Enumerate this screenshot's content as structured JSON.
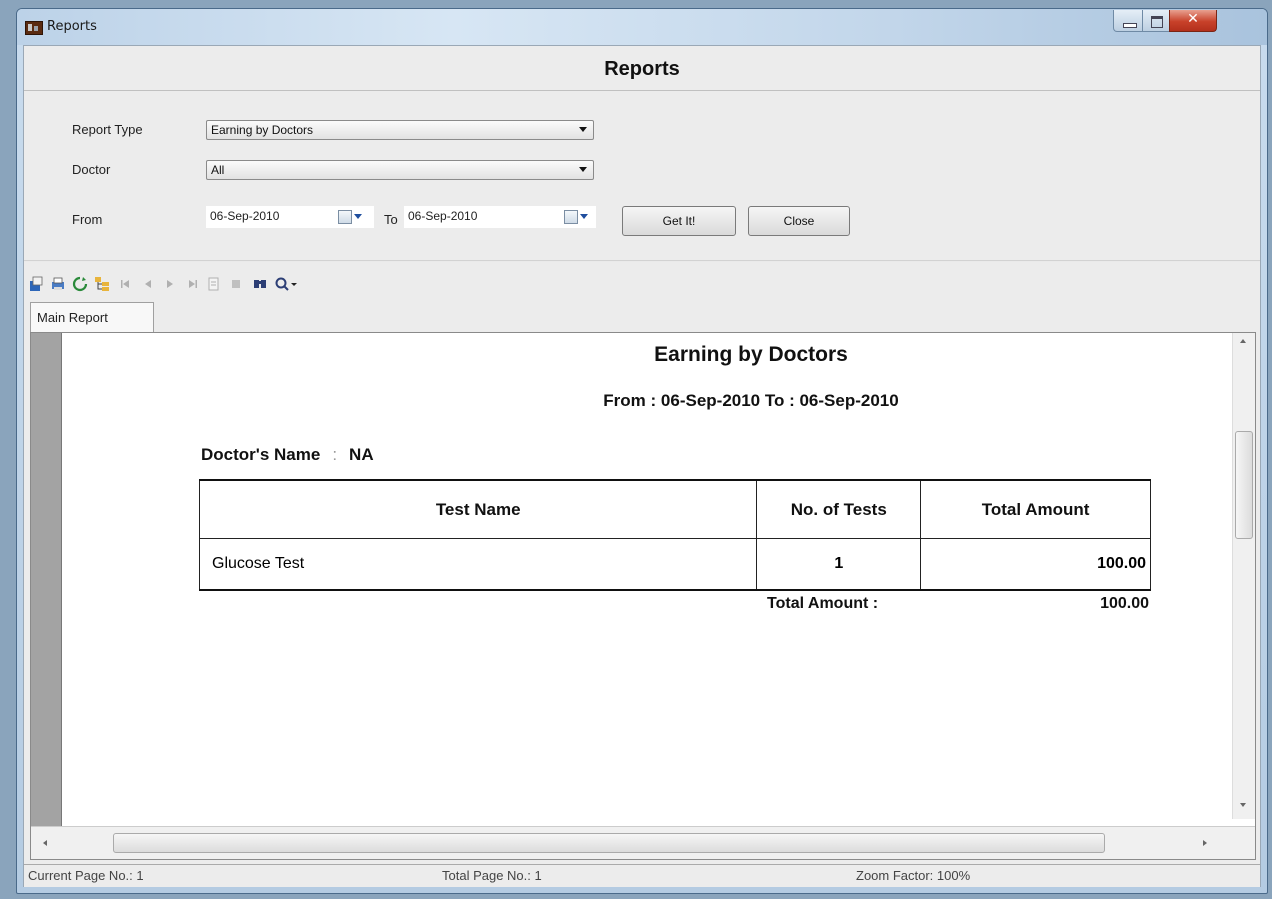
{
  "window": {
    "title": "Reports"
  },
  "header": {
    "title": "Reports"
  },
  "filters": {
    "report_type_label": "Report Type",
    "report_type_value": "Earning by Doctors",
    "doctor_label": "Doctor",
    "doctor_value": "All",
    "from_label": "From",
    "from_date": "06-Sep-2010",
    "to_label": "To",
    "to_date": "06-Sep-2010",
    "get_button": "Get It!",
    "close_button": "Close"
  },
  "viewer": {
    "toolbar_icons": [
      "export-icon",
      "print-icon",
      "refresh-icon",
      "group-tree-icon",
      "first-page-icon",
      "previous-page-icon",
      "next-page-icon",
      "last-page-icon",
      "goto-page-icon",
      "stop-icon",
      "search-icon",
      "zoom-icon"
    ],
    "tab": "Main Report"
  },
  "report": {
    "title": "Earning by Doctors",
    "subtitle": "From : 06-Sep-2010 To : 06-Sep-2010",
    "doctor_label": "Doctor's Name",
    "doctor_sep": ":",
    "doctor_value": "NA",
    "columns": [
      "Test Name",
      "No. of Tests",
      "Total Amount"
    ],
    "rows": [
      {
        "test": "Glucose Test",
        "count": "1",
        "amount": "100.00"
      }
    ],
    "total_label": "Total Amount :",
    "total_value": "100.00"
  },
  "status": {
    "current_page": "Current Page No.: 1",
    "total_page": "Total Page No.: 1",
    "zoom": "Zoom Factor: 100%"
  }
}
